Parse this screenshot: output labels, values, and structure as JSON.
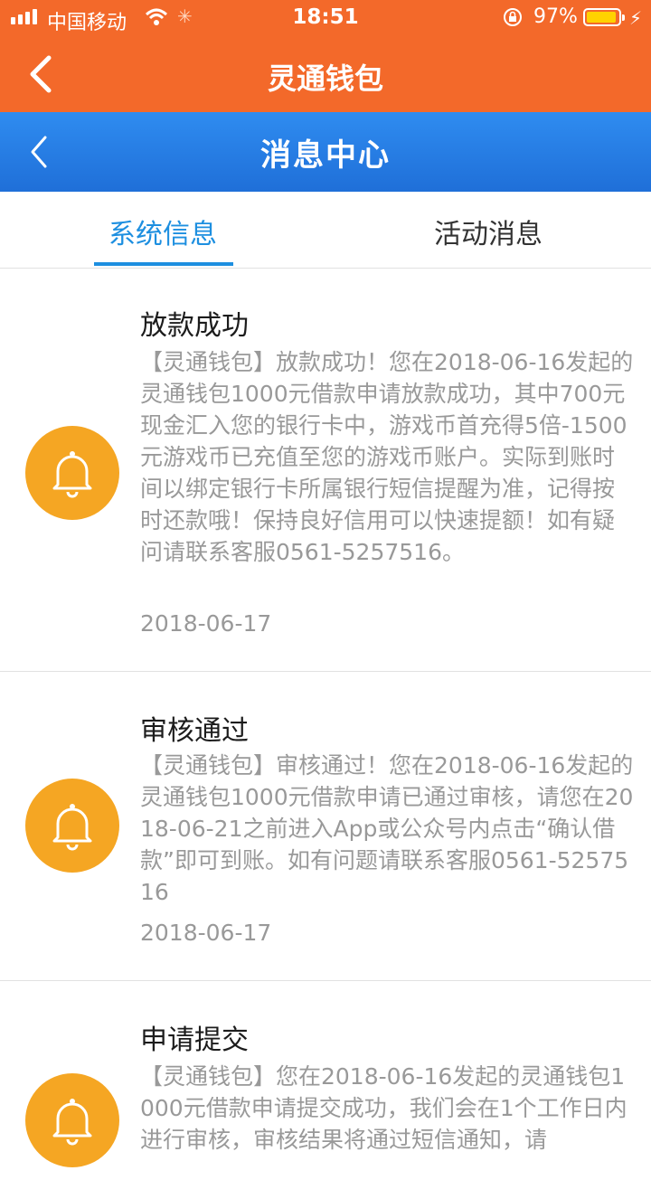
{
  "status_bar": {
    "carrier": "中国移动",
    "time": "18:51",
    "battery_percent": "97%"
  },
  "top_bar": {
    "title": "灵通钱包"
  },
  "header": {
    "title": "消息中心"
  },
  "tabs": [
    {
      "label": "系统信息",
      "active": true
    },
    {
      "label": "活动消息",
      "active": false
    }
  ],
  "messages": [
    {
      "title": "放款成功",
      "body": "【灵通钱包】放款成功！您在2018-06-16发起的灵通钱包1000元借款申请放款成功，其中700元现金汇入您的银行卡中，游戏币首充得5倍-1500元游戏币已充值至您的游戏币账户。实际到账时间以绑定银行卡所属银行短信提醒为准，记得按时还款哦！保持良好信用可以快速提额！如有疑问请联系客服0561-5257516。",
      "date": "2018-06-17",
      "icon": "bell-icon"
    },
    {
      "title": "审核通过",
      "body": "【灵通钱包】审核通过！您在2018-06-16发起的灵通钱包1000元借款申请已通过审核，请您在2018-06-21之前进入App或公众号内点击“确认借款”即可到账。如有问题请联系客服0561-5257516",
      "date": "2018-06-17",
      "icon": "bell-icon"
    },
    {
      "title": "申请提交",
      "body": "【灵通钱包】您在2018-06-16发起的灵通钱包1000元借款申请提交成功，我们会在1个工作日内进行审核，审核结果将通过短信通知，请",
      "date": "",
      "icon": "bell-icon"
    }
  ],
  "colors": {
    "orange": "#f3692a",
    "blue": "#1f6fd8",
    "accent": "#1d8fe0",
    "bell": "#f5a623"
  }
}
